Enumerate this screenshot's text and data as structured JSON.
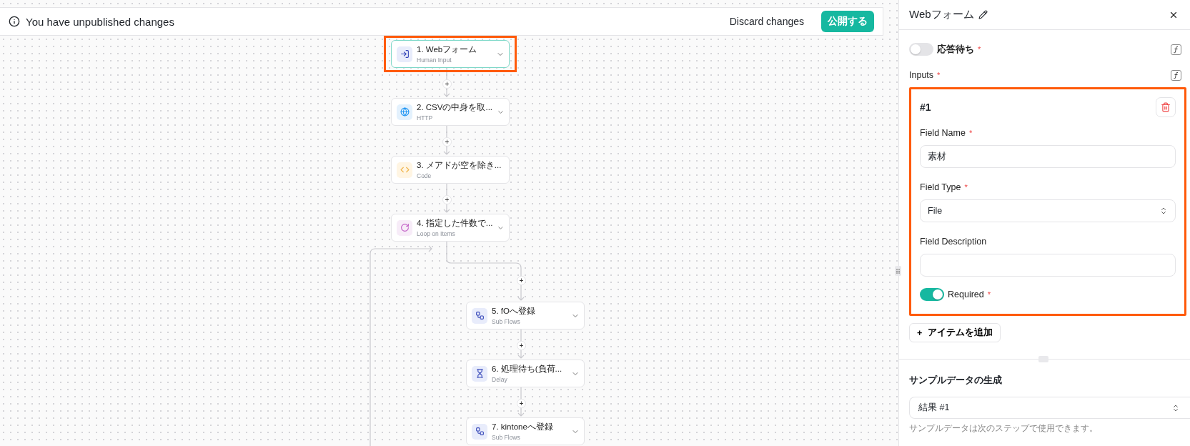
{
  "banner": {
    "message": "You have unpublished changes",
    "discard": "Discard changes",
    "publish": "公開する"
  },
  "nodes": [
    {
      "title": "1. Webフォーム",
      "subtitle": "Human Input",
      "kind": "input",
      "selected": true,
      "highlighted": true
    },
    {
      "title": "2. CSVの中身を取...",
      "subtitle": "HTTP",
      "kind": "http",
      "selected": false,
      "highlighted": false
    },
    {
      "title": "3. メアドが空を除き...",
      "subtitle": "Code",
      "kind": "code",
      "selected": false,
      "highlighted": false
    },
    {
      "title": "4. 指定した件数で...",
      "subtitle": "Loop on Items",
      "kind": "loop",
      "selected": false,
      "highlighted": false,
      "children": [
        {
          "title": "5. fOへ登録",
          "subtitle": "Sub Flows",
          "kind": "subflow",
          "selected": false,
          "highlighted": false
        },
        {
          "title": "6. 処理待ち(負荷...",
          "subtitle": "Delay",
          "kind": "delay",
          "selected": false,
          "highlighted": false
        },
        {
          "title": "7. kintoneへ登録",
          "subtitle": "Sub Flows",
          "kind": "subflow",
          "selected": false,
          "highlighted": false
        }
      ]
    }
  ],
  "panel": {
    "title": "Webフォーム",
    "wait_toggle": {
      "label": "応答待ち",
      "mark": "*",
      "on": false
    },
    "inputs": {
      "label": "Inputs",
      "mark": "*"
    },
    "items": [
      {
        "heading": "#1",
        "highlighted": true,
        "field_name": {
          "label": "Field Name",
          "mark": "*",
          "value": "素材"
        },
        "field_type": {
          "label": "Field Type",
          "mark": "*",
          "value": "File"
        },
        "field_description": {
          "label": "Field Description"
        },
        "required": {
          "label": "Required",
          "mark": "*",
          "on": true
        }
      }
    ],
    "add_item": {
      "icon": "+",
      "label": "アイテムを追加"
    },
    "sample": {
      "title": "サンプルデータの生成",
      "select": "結果 #1",
      "hint": "サンプルデータは次のステップで使用できます。"
    }
  }
}
